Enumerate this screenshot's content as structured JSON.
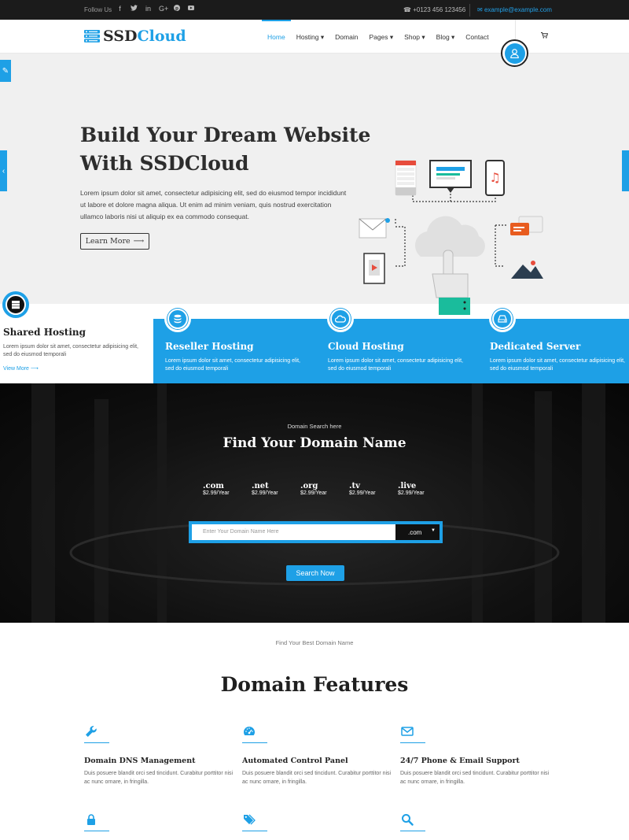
{
  "topbar": {
    "follow_label": "Follow Us",
    "social_icons": [
      "facebook-icon",
      "twitter-icon",
      "linkedin-icon",
      "google-plus-icon",
      "pinterest-icon",
      "youtube-icon"
    ],
    "phone": "+0123 456 123456",
    "email": "example@example.com"
  },
  "nav": {
    "logo_primary": "SSD",
    "logo_accent": "Cloud",
    "items": [
      {
        "label": "Home",
        "active": true
      },
      {
        "label": "Hosting ▾"
      },
      {
        "label": "Domain"
      },
      {
        "label": "Pages ▾"
      },
      {
        "label": "Shop ▾"
      },
      {
        "label": "Blog ▾"
      },
      {
        "label": "Contact"
      }
    ]
  },
  "hero": {
    "title_line1": "Build Your Dream Website",
    "title_line2": "With SSDCloud",
    "text": "Lorem ipsum dolor sit amet, consectetur adipisicing elit, sed do eiusmod tempor incididunt ut labore et dolore magna aliqua. Ut enim ad minim veniam, quis nostrud exercitation ullamco laboris nisi ut aliquip ex ea commodo consequat.",
    "button": "Learn More"
  },
  "services": [
    {
      "title": "Shared Hosting",
      "text": "Lorem ipsum dolor sit amet, consectetur adipisicing elit, sed do eiusmod temporali",
      "link": "View More"
    },
    {
      "title": "Reseller Hosting",
      "text": "Lorem ipsum dolor sit amet, consectetur adipisicing elit, sed do eiusmod temporali"
    },
    {
      "title": "Cloud Hosting",
      "text": "Lorem ipsum dolor sit amet, consectetur adipisicing elit, sed do eiusmod temporali"
    },
    {
      "title": "Dedicated Server",
      "text": "Lorem ipsum dolor sit amet, consectetur adipisicing elit, sed do eiusmod temporali"
    }
  ],
  "domain_search": {
    "subtitle": "Domain Search here",
    "title": "Find Your Domain Name",
    "tlds": [
      {
        "name": ".com",
        "price": "$2.99/Year"
      },
      {
        "name": ".net",
        "price": "$2.99/Year"
      },
      {
        "name": ".org",
        "price": "$2.99/Year"
      },
      {
        "name": ".tv",
        "price": "$2.99/Year"
      },
      {
        "name": ".live",
        "price": "$2.99/Year"
      }
    ],
    "placeholder": "Enter Your Domain Name Here",
    "selected_tld": ".com",
    "button": "Search Now"
  },
  "features": {
    "subtitle": "Find Your Best Domain Name",
    "title": "Domain Features",
    "items": [
      {
        "icon": "wrench-icon",
        "title": "Domain DNS Management",
        "text": "Duis posuere blandit orci sed tincidunt. Curabitur porttitor nisi ac nunc ornare, in fringilla."
      },
      {
        "icon": "dashboard-icon",
        "title": "Automated Control Panel",
        "text": "Duis posuere blandit orci sed tincidunt. Curabitur porttitor nisi ac nunc ornare, in fringilla."
      },
      {
        "icon": "envelope-icon",
        "title": "24/7 Phone & Email Support",
        "text": "Duis posuere blandit orci sed tincidunt. Curabitur porttitor nisi ac nunc ornare, in fringilla."
      },
      {
        "icon": "lock-icon",
        "title": "",
        "text": ""
      },
      {
        "icon": "tags-icon",
        "title": "",
        "text": ""
      },
      {
        "icon": "search-icon",
        "title": "",
        "text": ""
      }
    ]
  },
  "colors": {
    "accent": "#1ea0e6",
    "dark": "#1b1b1b",
    "hero_bg": "#f0f0f0"
  }
}
